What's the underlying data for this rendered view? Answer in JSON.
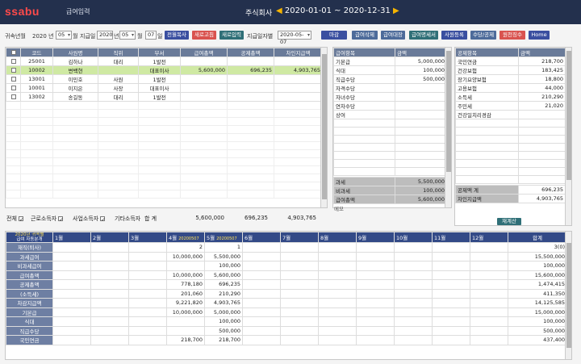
{
  "header": {
    "logo": "ssabu",
    "app_title": "급여입력",
    "company": "주식회사",
    "period": "2020-01-01 ~ 2020-12-31",
    "prev_arrow": "◀",
    "next_arrow": "▶"
  },
  "toolbar": {
    "year_label": "귀속년월",
    "year_value": "2020 년",
    "month_value": "05",
    "month_unit": "월",
    "paydate_label": "지급일",
    "pay_year": "2020",
    "pay_year_unit": "년",
    "pay_month": "05",
    "pay_month_unit": "월",
    "pay_day": "07",
    "pay_day_unit": "일",
    "btn_copy": "전월복사",
    "btn_reload": "새로고침",
    "btn_new": "새로입력",
    "paydiff_label": "지급일자별",
    "paydiff_value": "2020-05-07",
    "btn_close": "마감",
    "btn_item_delete": "급여삭제",
    "btn_ledger": "급여대장",
    "btn_slip": "급여명세서",
    "btn_employee": "사원등록",
    "btn_allowance": "수당/공제",
    "btn_withholding": "원천징수",
    "btn_home": "Home"
  },
  "employees": {
    "columns": [
      "",
      "코드",
      "사원명",
      "직위",
      "부서",
      "급여총액",
      "공제총액",
      "차인지급액"
    ],
    "rows": [
      {
        "code": "25001",
        "name": "김하나",
        "title": "대리",
        "dept": "1발전",
        "gross": "",
        "deduct": "",
        "net": "",
        "selected": false
      },
      {
        "code": "10002",
        "name": "변백현",
        "title": "",
        "dept": "대표이사",
        "gross": "5,600,000",
        "deduct": "696,235",
        "net": "4,903,765",
        "selected": true
      },
      {
        "code": "13001",
        "name": "이민호",
        "title": "사원",
        "dept": "1발전",
        "gross": "",
        "deduct": "",
        "net": "",
        "selected": false
      },
      {
        "code": "10001",
        "name": "이지은",
        "title": "사장",
        "dept": "대표이사",
        "gross": "",
        "deduct": "",
        "net": "",
        "selected": false
      },
      {
        "code": "13002",
        "name": "송길동",
        "title": "대리",
        "dept": "1발전",
        "gross": "",
        "deduct": "",
        "net": "",
        "selected": false
      }
    ],
    "footer": {
      "all": "전체",
      "earned": "근로소득자",
      "business": "사업소득자",
      "other": "기타소득자",
      "total_label": "합 계",
      "gross": "5,600,000",
      "deduct": "696,235",
      "net": "4,903,765"
    }
  },
  "pay_items": {
    "columns": [
      "급여항목",
      "금액"
    ],
    "rows": [
      {
        "item": "기본급",
        "amount": "5,000,000"
      },
      {
        "item": "식대",
        "amount": "100,000"
      },
      {
        "item": "직급수당",
        "amount": "500,000"
      },
      {
        "item": "자격수당",
        "amount": ""
      },
      {
        "item": "자녀수당",
        "amount": ""
      },
      {
        "item": "연차수당",
        "amount": ""
      },
      {
        "item": "상여",
        "amount": ""
      }
    ],
    "taxable_label": "과세",
    "taxable": "5,500,000",
    "nontax_label": "비과세",
    "nontax": "100,000",
    "total_label": "급여총액",
    "total": "5,600,000",
    "memo": "메모"
  },
  "deduct_items": {
    "columns": [
      "공제항목",
      "금액"
    ],
    "rows": [
      {
        "item": "국민연금",
        "amount": "218,700"
      },
      {
        "item": "건강보험",
        "amount": "183,425"
      },
      {
        "item": "장기요양보험",
        "amount": "18,800"
      },
      {
        "item": "고용보험",
        "amount": "44,000"
      },
      {
        "item": "소득세",
        "amount": "210,290"
      },
      {
        "item": "주민세",
        "amount": "21,020"
      },
      {
        "item": "건강일치리경감",
        "amount": ""
      }
    ],
    "total_label": "공제액 계",
    "total": "696,235",
    "net_label": "차인지급액",
    "net": "4,903,765",
    "recalc": "재계산"
  },
  "annual": {
    "corner_line1": "2020년 귀속별",
    "corner_line2": "급여 자동분개",
    "months": [
      "1월",
      "2월",
      "3월",
      "4월",
      "5월",
      "6월",
      "7월",
      "8월",
      "9월",
      "10월",
      "11월",
      "12월"
    ],
    "date_tag_4": "20200507",
    "date_tag_5": "20200507",
    "total_header": "합계",
    "rows": [
      {
        "label": "재직(퇴사)",
        "m4": "2",
        "m5": "1",
        "total": "3(0)"
      },
      {
        "label": "과세급여",
        "m4": "10,000,000",
        "m5": "5,500,000",
        "total": "15,500,000"
      },
      {
        "label": "비과세급여",
        "m4": "",
        "m5": "100,000",
        "total": "100,000"
      },
      {
        "label": "급여총액",
        "m4": "10,000,000",
        "m5": "5,600,000",
        "total": "15,600,000"
      },
      {
        "label": "공제총액",
        "m4": "778,180",
        "m5": "696,235",
        "total": "1,474,415"
      },
      {
        "label": "(소득세)",
        "m4": "201,060",
        "m5": "210,290",
        "total": "411,350"
      },
      {
        "label": "차감지급액",
        "m4": "9,221,820",
        "m5": "4,903,765",
        "total": "14,125,585"
      },
      {
        "label": "기본급",
        "m4": "10,000,000",
        "m5": "5,000,000",
        "total": "15,000,000"
      },
      {
        "label": "식대",
        "m4": "",
        "m5": "100,000",
        "total": "100,000"
      },
      {
        "label": "직급수당",
        "m4": "",
        "m5": "500,000",
        "total": "500,000"
      },
      {
        "label": "국민연금",
        "m4": "218,700",
        "m5": "218,700",
        "total": "437,400"
      }
    ]
  }
}
